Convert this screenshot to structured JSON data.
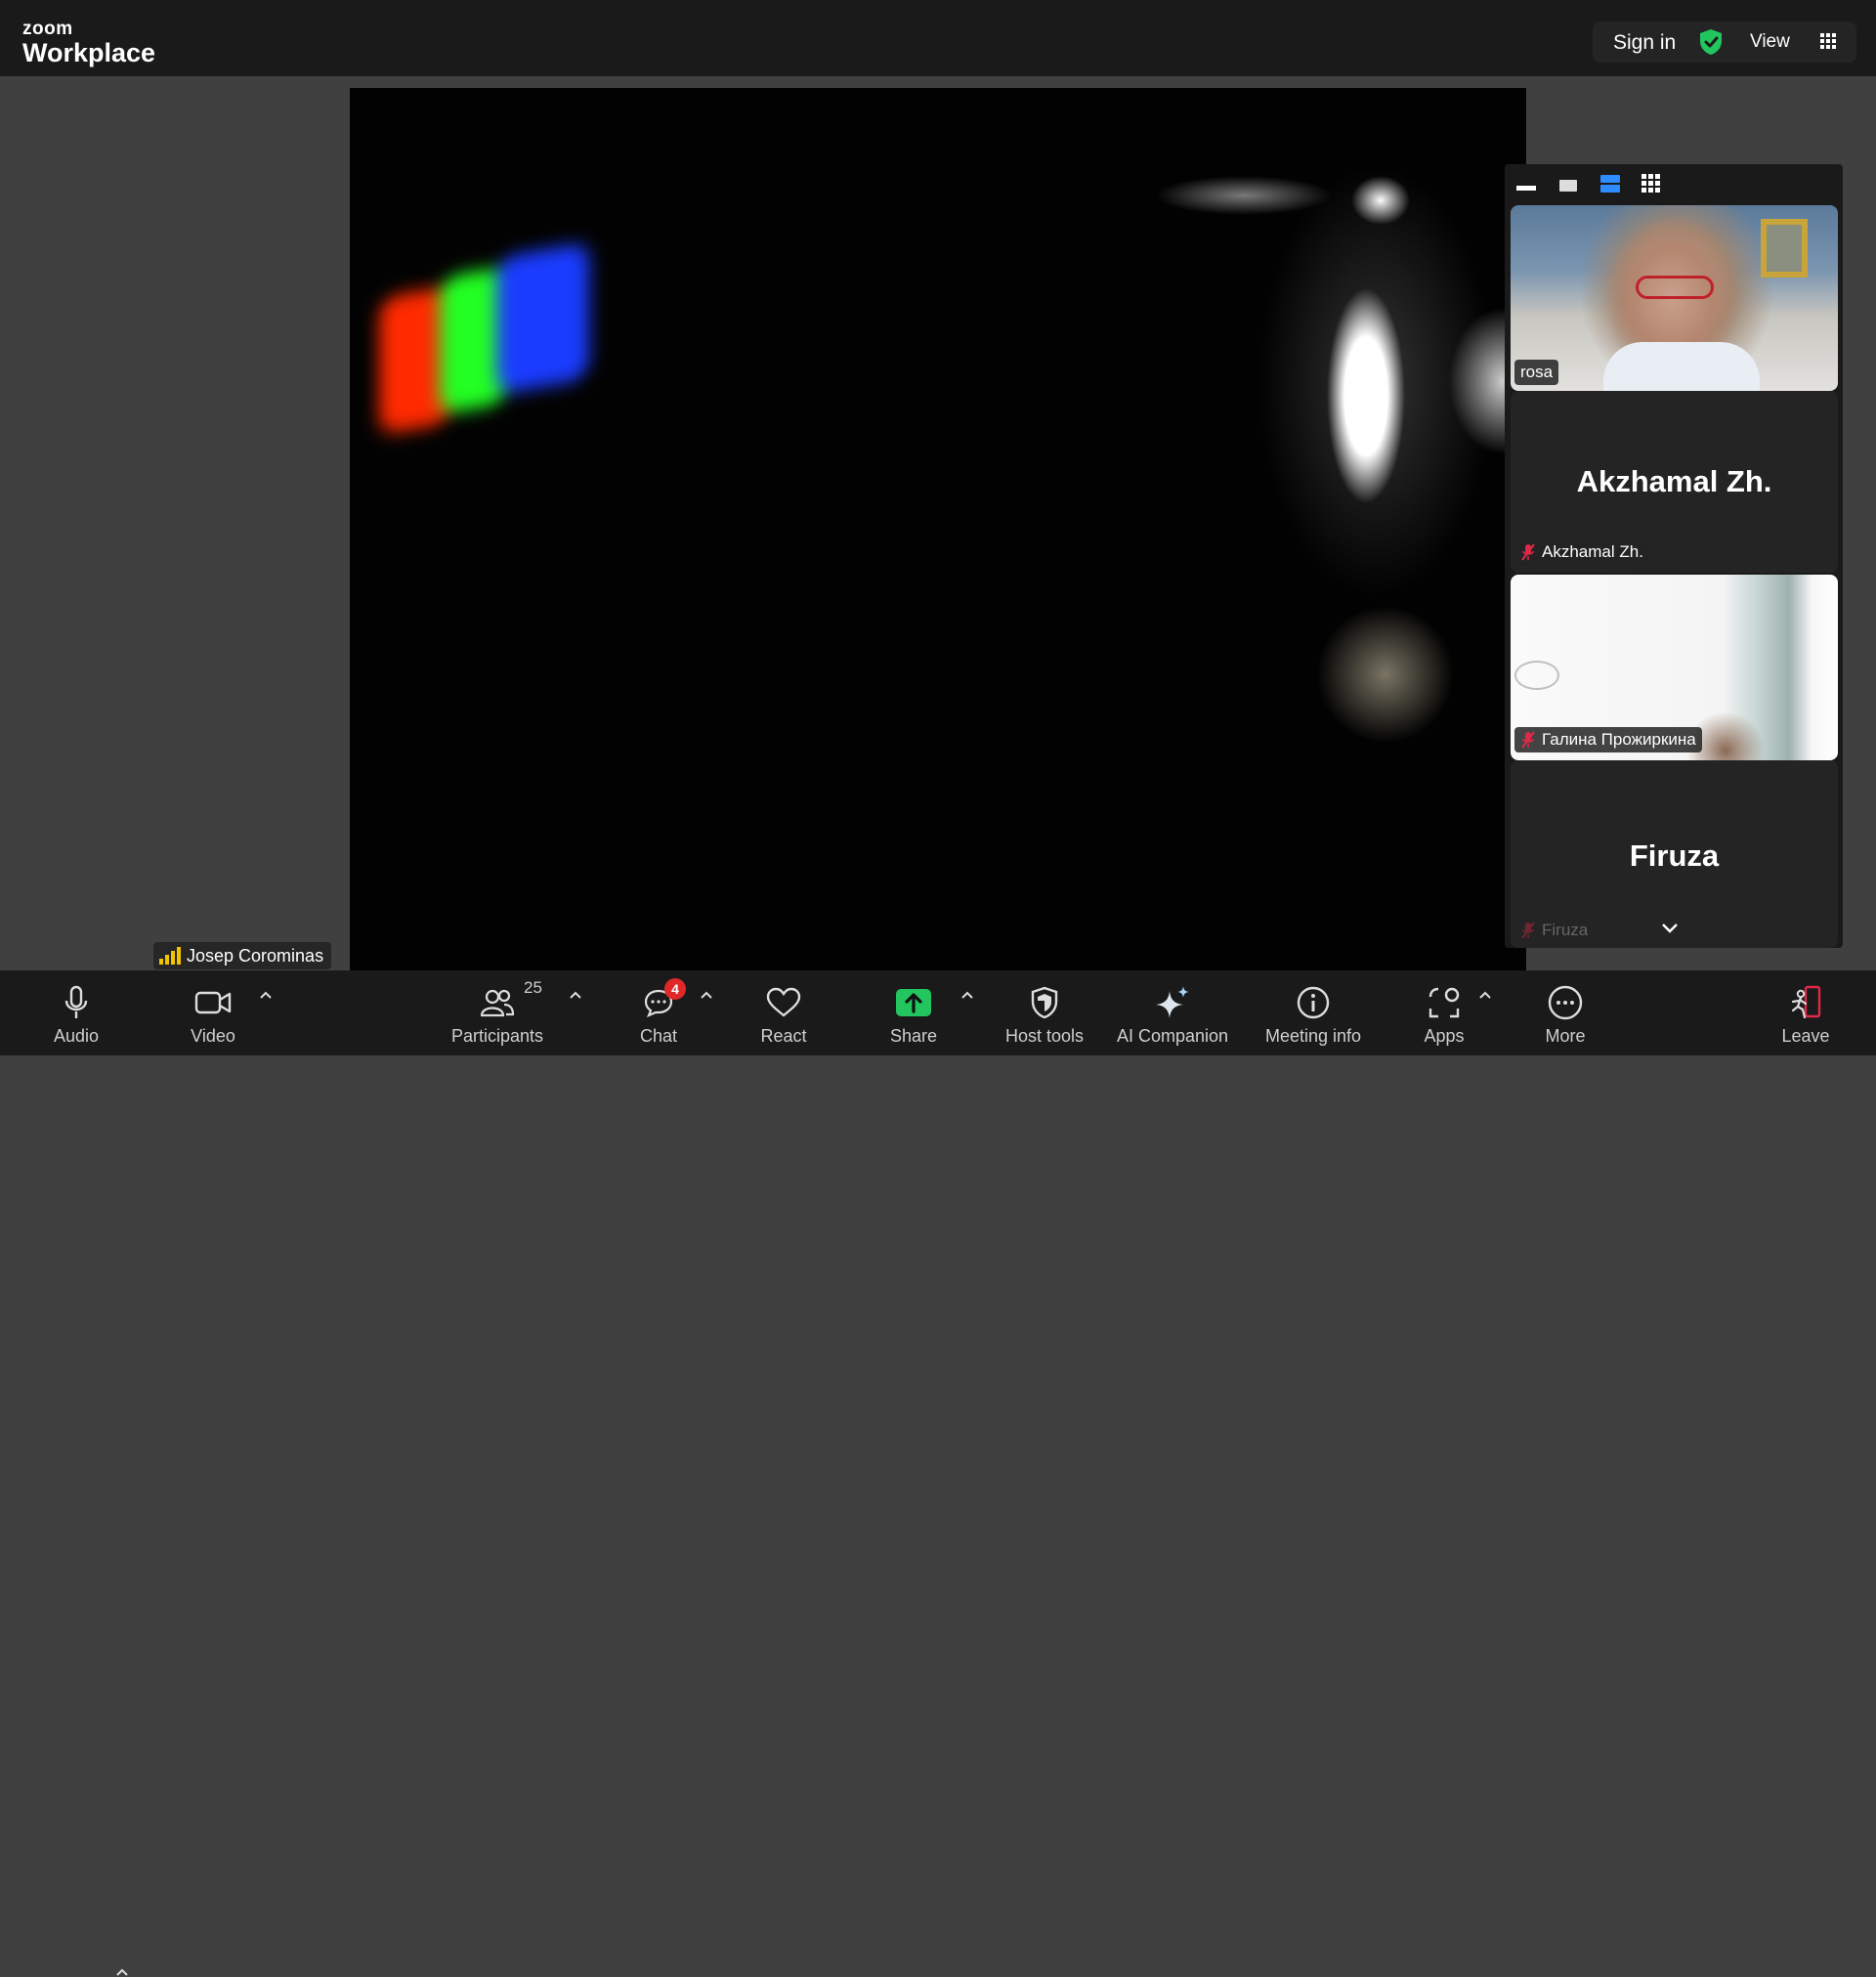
{
  "topbar": {
    "logo_small": "zoom",
    "logo_large": "Workplace",
    "sign_in": "Sign in",
    "view": "View"
  },
  "main_video": {
    "speaker_name": "Josep Corominas"
  },
  "gallery": {
    "tiles": [
      {
        "name": "rosa",
        "camera": true,
        "muted": false
      },
      {
        "name": "Akzhamal Zh.",
        "display_name": "Akzhamal Zh.",
        "camera": false,
        "muted": true
      },
      {
        "name": "Галина Прожиркина",
        "camera": true,
        "muted": true
      },
      {
        "name": "Firuza",
        "display_name": "Firuza",
        "camera": false,
        "muted": true
      }
    ]
  },
  "toolbar": {
    "audio": "Audio",
    "video": "Video",
    "participants": "Participants",
    "participants_count": "25",
    "chat": "Chat",
    "chat_badge": "4",
    "react": "React",
    "share": "Share",
    "host_tools": "Host tools",
    "ai_companion": "AI Companion",
    "meeting_info": "Meeting info",
    "apps": "Apps",
    "more": "More",
    "leave": "Leave"
  },
  "colors": {
    "share_green": "#22c55e",
    "shield_green": "#22c55e",
    "badge_red": "#e02828",
    "leave_red": "#e02848",
    "signal_yellow": "#f2c400",
    "view_active_blue": "#2d8cff"
  }
}
